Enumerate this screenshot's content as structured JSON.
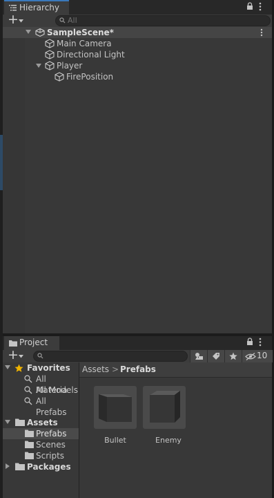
{
  "hierarchy": {
    "tab_label": "Hierarchy",
    "add_label": "+",
    "search_placeholder": "All",
    "scene_name": "SampleScene*",
    "items": [
      {
        "label": "Main Camera"
      },
      {
        "label": "Directional Light"
      },
      {
        "label": "Player"
      },
      {
        "label": "FirePosition"
      }
    ]
  },
  "project": {
    "tab_label": "Project",
    "add_label": "+",
    "search_placeholder": "",
    "hidden_count": "10",
    "sidebar": {
      "favorites_label": "Favorites",
      "favorites": [
        "All Materia",
        "All Models",
        "All Prefabs"
      ],
      "assets_label": "Assets",
      "folders": [
        "Prefabs",
        "Scenes",
        "Scripts"
      ],
      "packages_label": "Packages"
    },
    "breadcrumb": {
      "root": "Assets",
      "separator": ">",
      "current": "Prefabs"
    },
    "assets": [
      {
        "label": "Bullet"
      },
      {
        "label": "Enemy"
      }
    ]
  },
  "colors": {
    "accent": "#3a79bb",
    "panel": "#383838",
    "star": "#f0b400"
  },
  "icons": [
    "list-icon",
    "lock-icon",
    "more-icon",
    "search-icon",
    "gameobject-icon",
    "unity-scene-icon",
    "star-icon",
    "folder-icon",
    "filter-icon",
    "tag-icon",
    "eye-hidden-icon",
    "chevron-down-icon"
  ]
}
